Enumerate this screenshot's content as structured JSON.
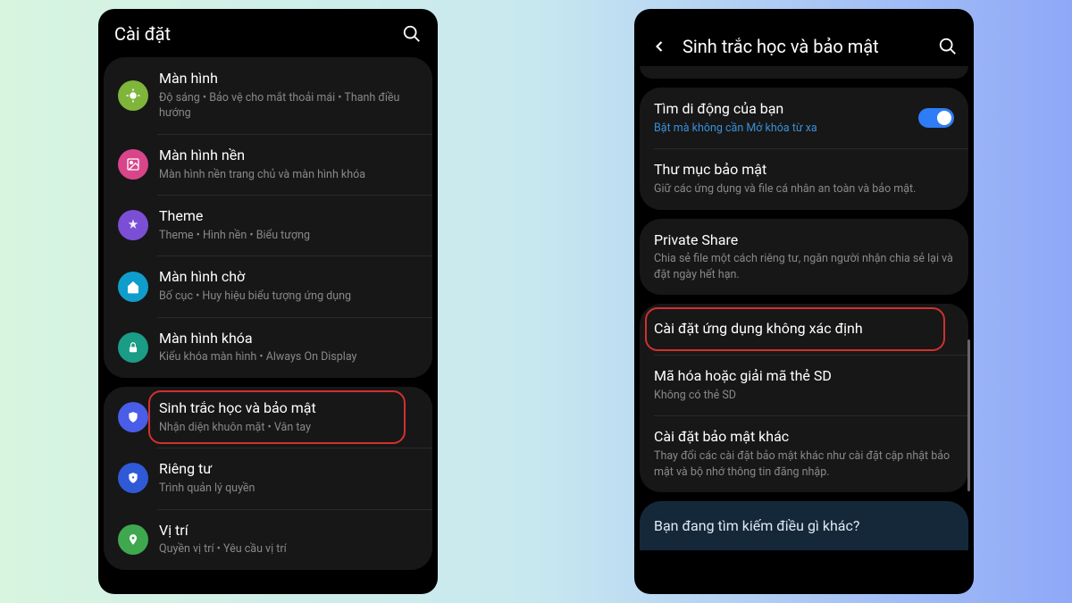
{
  "left": {
    "header_title": "Cài đặt",
    "rows": [
      {
        "icon": "display",
        "color": "#7fb53a",
        "title": "Màn hình",
        "sub": "Độ sáng  •  Bảo vệ cho mắt thoải mái  •  Thanh điều hướng"
      },
      {
        "icon": "wallpaper",
        "color": "#d9458a",
        "title": "Màn hình nền",
        "sub": "Màn hình nền trang chủ và màn hình khóa"
      },
      {
        "icon": "theme",
        "color": "#7a4fd6",
        "title": "Theme",
        "sub": "Theme  •  Hình nền  •  Biểu tượng"
      },
      {
        "icon": "home",
        "color": "#0f9ecc",
        "title": "Màn hình chờ",
        "sub": "Bố cục  •  Huy hiệu biểu tượng ứng dụng"
      },
      {
        "icon": "lock",
        "color": "#1a9c86",
        "title": "Màn hình khóa",
        "sub": "Kiểu khóa màn hình  •  Always On Display"
      },
      {
        "icon": "shield",
        "color": "#4a5de8",
        "title": "Sinh trắc học và bảo mật",
        "sub": "Nhận diện khuôn mặt  •  Vân tay",
        "hl": true
      },
      {
        "icon": "privacy",
        "color": "#3059d8",
        "title": "Riêng tư",
        "sub": "Trình quản lý quyền"
      },
      {
        "icon": "location",
        "color": "#3fa84f",
        "title": "Vị trí",
        "sub": "Quyền vị trí  •  Yêu cầu vị trí"
      }
    ]
  },
  "right": {
    "header_title": "Sinh trắc học và bảo mật",
    "rows1": [
      {
        "title": "Tìm di động của bạn",
        "sub": "Bật mà không cần Mở khóa từ xa",
        "subblue": true,
        "toggle": true
      },
      {
        "title": "Thư mục bảo mật",
        "sub": "Giữ các ứng dụng và file cá nhân an toàn và bảo mật."
      }
    ],
    "rows2": [
      {
        "title": "Private Share",
        "sub": "Chia sẻ file một cách riêng tư, ngăn người nhận chia sẻ lại và đặt ngày hết hạn."
      }
    ],
    "rows3": [
      {
        "title": "Cài đặt ứng dụng không xác định",
        "hl": true
      },
      {
        "title": "Mã hóa hoặc giải mã thẻ SD",
        "sub": "Không có thẻ SD"
      },
      {
        "title": "Cài đặt bảo mật khác",
        "sub": "Thay đổi các cài đặt bảo mật khác như cài đặt cập nhật bảo mật và bộ nhớ thông tin đăng nhập."
      }
    ],
    "footer": "Bạn đang tìm kiếm điều gì khác?"
  }
}
